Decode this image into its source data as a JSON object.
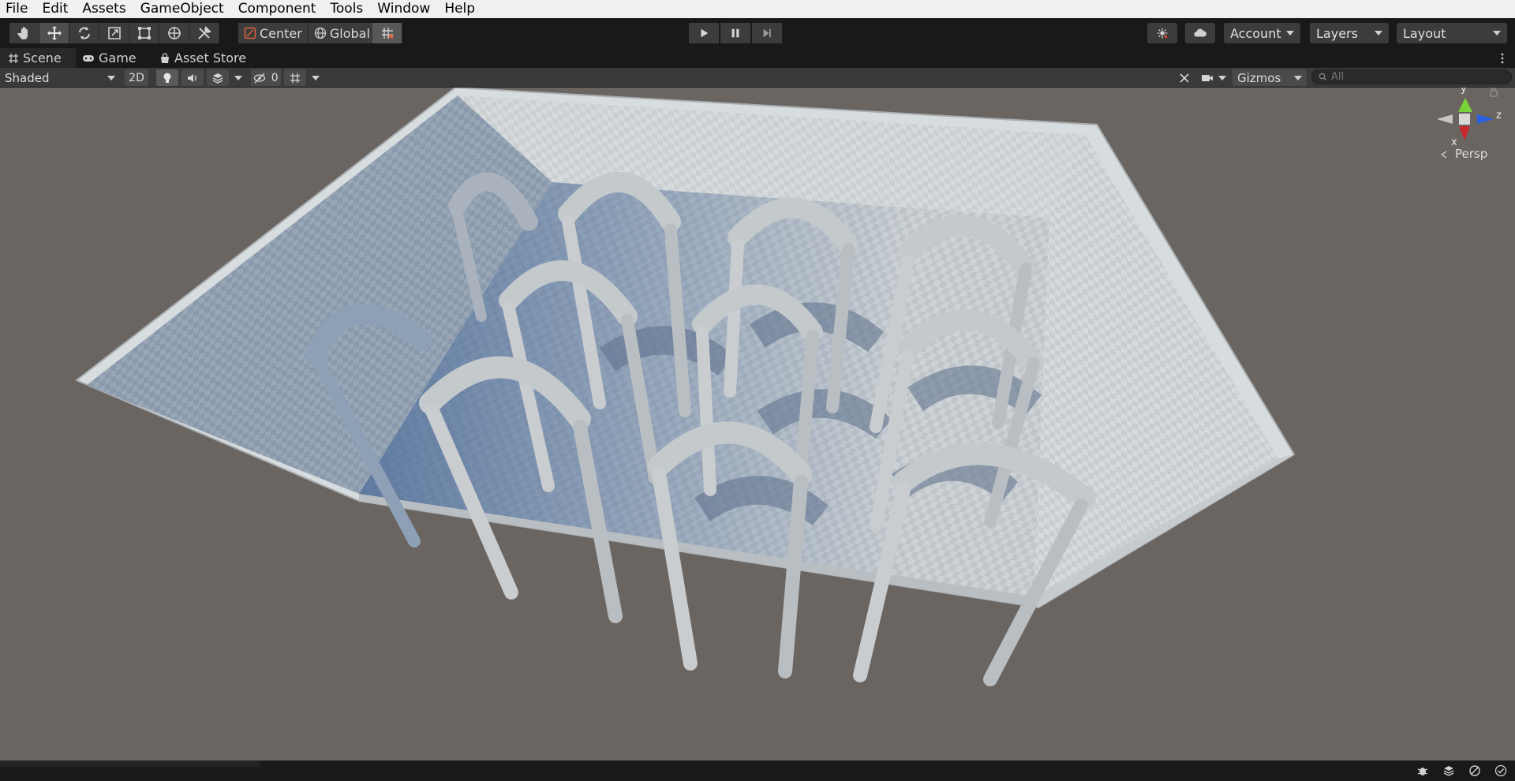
{
  "menu": [
    "File",
    "Edit",
    "Assets",
    "GameObject",
    "Component",
    "Tools",
    "Window",
    "Help"
  ],
  "toolbar": {
    "tools": [
      "hand-tool",
      "move-tool",
      "rotate-tool",
      "scale-tool",
      "rect-tool",
      "transform-tool",
      "custom-tool"
    ],
    "pivot_label": "Center",
    "space_label": "Global",
    "account_label": "Account",
    "layers_label": "Layers",
    "layout_label": "Layout"
  },
  "tabs": [
    "Scene",
    "Game",
    "Asset Store"
  ],
  "scene_toolbar": {
    "draw_mode": "Shaded",
    "mode_2d": "2D",
    "hidden_count": "0",
    "gizmos_label": "Gizmos",
    "search_placeholder": "All"
  },
  "gizmo": {
    "axis_y": "y",
    "axis_z": "z",
    "axis_x": "x",
    "projection": "Persp"
  },
  "colors": {
    "accent_blue": "#3c5f91",
    "axis_red": "#c8282c",
    "axis_green": "#7ad23a",
    "axis_blue": "#2a60e0"
  }
}
